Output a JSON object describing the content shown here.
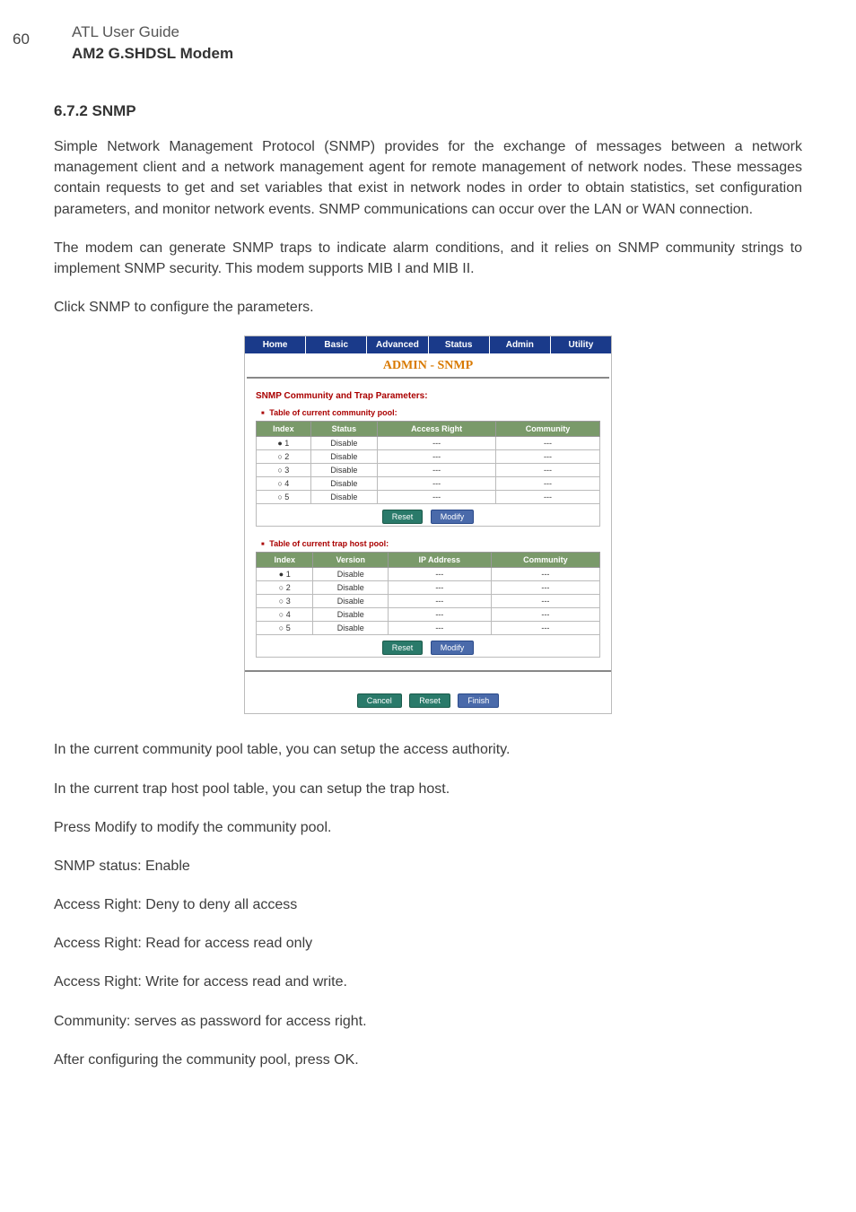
{
  "page_number": "60",
  "header": {
    "line1": "ATL User Guide",
    "line2": "AM2 G.SHDSL Modem"
  },
  "section": {
    "number_title": "6.7.2  SNMP"
  },
  "paragraphs": {
    "p1": "Simple Network Management Protocol (SNMP) provides for the exchange of messages between a network management client and a network management agent for remote management of network nodes. These messages contain requests to get and set variables that exist in network nodes in order to obtain statistics, set configuration parameters, and monitor network events. SNMP communications can occur over the LAN or WAN connection.",
    "p2": "The modem can generate SNMP traps to indicate alarm conditions, and it relies on SNMP community strings to implement SNMP security. This modem supports MIB I and MIB II.",
    "p3": "Click SNMP to configure the parameters.",
    "p4": "In the current community pool table, you can setup the access authority.",
    "p5": "In the current trap host pool table, you can setup the trap host.",
    "p6": "Press Modify to modify the community pool.",
    "p7": "SNMP status: Enable",
    "p8": "Access Right: Deny to deny all access",
    "p9": "Access Right: Read for access read only",
    "p10": "Access Right: Write for access read and write.",
    "p11": "Community: serves as password for access right.",
    "p12": "After configuring the community pool, press OK."
  },
  "embed": {
    "tabs": [
      "Home",
      "Basic",
      "Advanced",
      "Status",
      "Admin",
      "Utility"
    ],
    "title": "ADMIN - SNMP",
    "subhead": "SNMP Community and Trap Parameters:",
    "community_pool": {
      "bullet": "Table of current community pool:",
      "headers": [
        "Index",
        "Status",
        "Access Right",
        "Community"
      ],
      "rows": [
        {
          "sel": "●",
          "idx": "1",
          "status": "Disable",
          "ar": "---",
          "comm": "---"
        },
        {
          "sel": "○",
          "idx": "2",
          "status": "Disable",
          "ar": "---",
          "comm": "---"
        },
        {
          "sel": "○",
          "idx": "3",
          "status": "Disable",
          "ar": "---",
          "comm": "---"
        },
        {
          "sel": "○",
          "idx": "4",
          "status": "Disable",
          "ar": "---",
          "comm": "---"
        },
        {
          "sel": "○",
          "idx": "5",
          "status": "Disable",
          "ar": "---",
          "comm": "---"
        }
      ],
      "btn_reset": "Reset",
      "btn_modify": "Modify"
    },
    "trap_pool": {
      "bullet": "Table of current trap host pool:",
      "headers": [
        "Index",
        "Version",
        "IP Address",
        "Community"
      ],
      "rows": [
        {
          "sel": "●",
          "idx": "1",
          "ver": "Disable",
          "ip": "---",
          "comm": "---"
        },
        {
          "sel": "○",
          "idx": "2",
          "ver": "Disable",
          "ip": "---",
          "comm": "---"
        },
        {
          "sel": "○",
          "idx": "3",
          "ver": "Disable",
          "ip": "---",
          "comm": "---"
        },
        {
          "sel": "○",
          "idx": "4",
          "ver": "Disable",
          "ip": "---",
          "comm": "---"
        },
        {
          "sel": "○",
          "idx": "5",
          "ver": "Disable",
          "ip": "---",
          "comm": "---"
        }
      ],
      "btn_reset": "Reset",
      "btn_modify": "Modify"
    },
    "bottom_buttons": {
      "cancel": "Cancel",
      "reset": "Reset",
      "finish": "Finish"
    }
  }
}
